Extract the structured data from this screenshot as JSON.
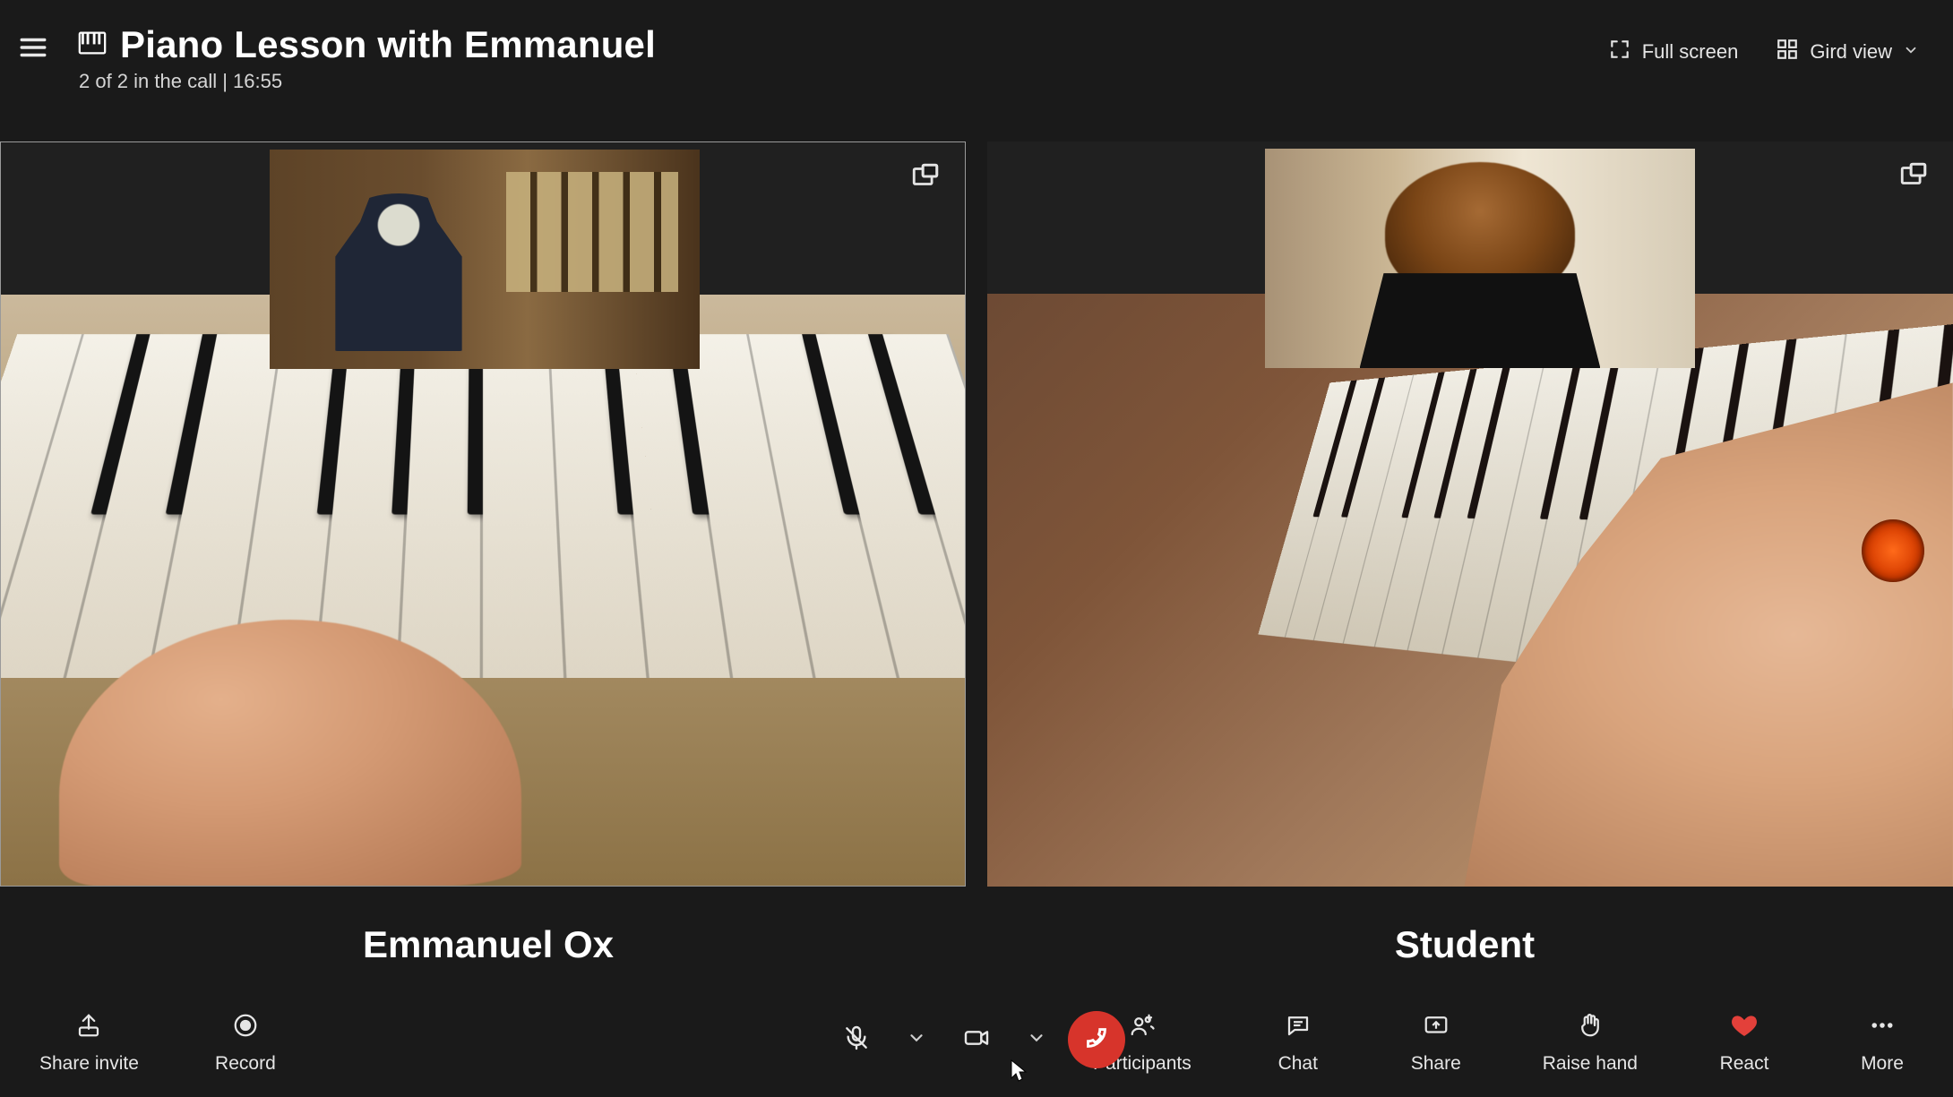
{
  "header": {
    "title": "Piano Lesson with Emmanuel",
    "subtitle": "2 of 2 in the call  |  16:55",
    "fullscreen_label": "Full screen",
    "view_label": "Gird view"
  },
  "participants": {
    "left_name": "Emmanuel Ox",
    "right_name": "Student"
  },
  "bottom": {
    "share_invite": "Share invite",
    "record": "Record",
    "participants": "Participants",
    "chat": "Chat",
    "share": "Share",
    "raise_hand": "Raise hand",
    "react": "React",
    "more": "More"
  },
  "icons": {
    "hamburger": "menu-icon",
    "piano": "piano-icon",
    "fullscreen": "fullscreen-icon",
    "grid": "grid-icon",
    "chevron_down": "chevron-down-icon",
    "pop_out": "pop-out-icon",
    "share_invite": "share-arrow-icon",
    "record": "record-icon",
    "mic_muted": "mic-muted-icon",
    "camera": "camera-icon",
    "hang_up": "hang-up-icon",
    "participants": "people-icon",
    "chat": "chat-icon",
    "share_screen": "share-screen-icon",
    "raise_hand": "raise-hand-icon",
    "react": "heart-icon",
    "more": "more-icon"
  },
  "colors": {
    "hang_up": "#d7342b",
    "heart": "#e3403a",
    "bg": "#1a1a1a"
  },
  "call": {
    "participant_count": 2,
    "total_slots": 2,
    "duration": "16:55"
  }
}
